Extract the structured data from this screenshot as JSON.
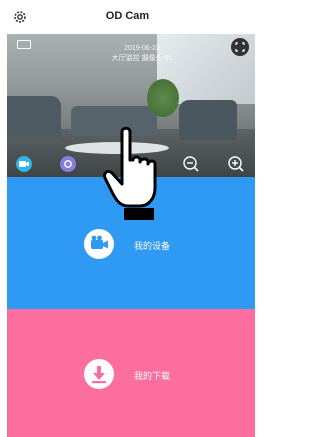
{
  "app": {
    "title": "OD Cam"
  },
  "preview": {
    "overlay_line1": "2019-06-22",
    "overlay_line2": "大厅监控 摄像头 01"
  },
  "tiles": {
    "devices_label": "我的设备",
    "downloads_label": "我的下载"
  },
  "icons": {
    "settings": "gear-icon",
    "fullscreen": "fullscreen-icon",
    "camera": "camera-icon",
    "snapshot": "snapshot-icon",
    "record": "record-icon",
    "zoom_out": "zoom-out-icon",
    "zoom_in": "zoom-in-icon",
    "devices": "video-camera-icon",
    "downloads": "download-icon",
    "hand": "tap-hand-icon"
  },
  "colors": {
    "devices_tile": "#2f9af3",
    "downloads_tile": "#fb6e9e",
    "record": "#f04545"
  }
}
